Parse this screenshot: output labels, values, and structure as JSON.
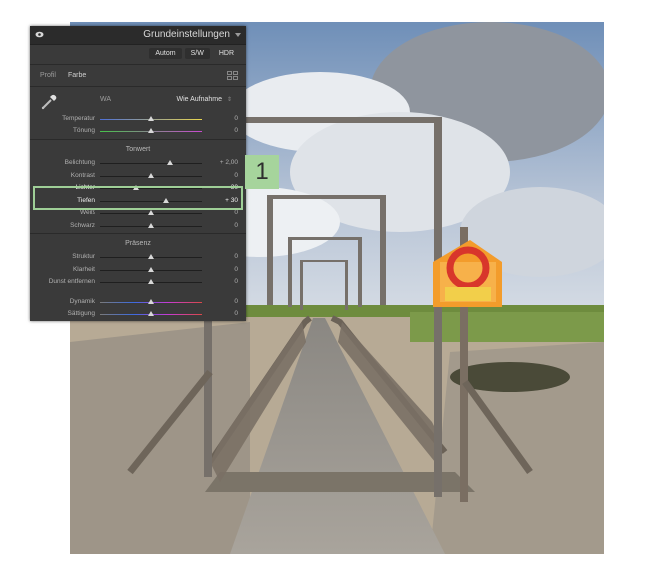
{
  "panel": {
    "title": "Grundeinstellungen",
    "modes": [
      "Autom",
      "S/W",
      "HDR"
    ],
    "profile_label": "Profil",
    "profile_value": "Farbe",
    "wb_label": "WA",
    "wb_value": "Wie Aufnahme",
    "wb_sliders": [
      {
        "label": "Temperatur",
        "value": "0",
        "pos": 0.5,
        "gradient": "linear-gradient(90deg,#4d6fd6,#e9d64e)"
      },
      {
        "label": "Tönung",
        "value": "0",
        "pos": 0.5,
        "gradient": "linear-gradient(90deg,#46c24a,#c94ad0)"
      }
    ],
    "tone_title": "Tonwert",
    "tone_sliders": [
      {
        "label": "Belichtung",
        "value": "+ 2,00",
        "pos": 0.69
      },
      {
        "label": "Kontrast",
        "value": "0",
        "pos": 0.5
      },
      {
        "label": "Lichter",
        "value": "– 30",
        "pos": 0.35
      },
      {
        "label": "Tiefen",
        "value": "+ 30",
        "pos": 0.65
      },
      {
        "label": "Weiß",
        "value": "0",
        "pos": 0.5
      },
      {
        "label": "Schwarz",
        "value": "0",
        "pos": 0.5
      }
    ],
    "presence_title": "Präsenz",
    "presence_sliders": [
      {
        "label": "Struktur",
        "value": "0",
        "pos": 0.5
      },
      {
        "label": "Klarheit",
        "value": "0",
        "pos": 0.5
      },
      {
        "label": "Dunst entfernen",
        "value": "0",
        "pos": 0.5
      },
      {
        "label": "Dynamik",
        "value": "0",
        "pos": 0.5,
        "gradient": "linear-gradient(90deg,#7a7a7a,#3c6be0,#c63bd4,#d84848)"
      },
      {
        "label": "Sättigung",
        "value": "0",
        "pos": 0.5,
        "gradient": "linear-gradient(90deg,#7a7a7a,#3c6be0,#c63bd4,#d84848)"
      }
    ]
  },
  "callout": {
    "number": "1"
  },
  "colors": {
    "accent": "#a6d49c",
    "panel_bg": "#3a3a3a",
    "header_bg": "#2b2b2b"
  }
}
